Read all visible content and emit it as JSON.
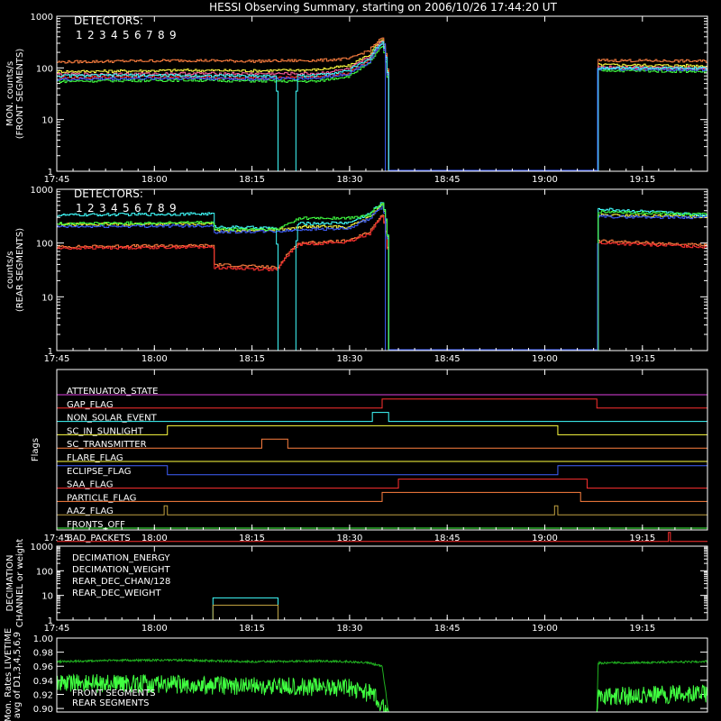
{
  "title": "HESSI Observing Summary, starting on 2006/10/26 17:44:20 UT",
  "time_ticks": [
    "17:45",
    "18:00",
    "18:15",
    "18:30",
    "18:45",
    "19:00",
    "19:15"
  ],
  "time_minutes": [
    0,
    15,
    30,
    45,
    60,
    75,
    90
  ],
  "detectors_label": "DETECTORS:",
  "detector_numbers": [
    "1",
    "2",
    "3",
    "4",
    "5",
    "6",
    "7",
    "8",
    "9"
  ],
  "detector_colors": [
    "#ff3030",
    "#ff60a0",
    "#ff8040",
    "#ffff40",
    "#c0ff40",
    "#40ff40",
    "#40ffa0",
    "#40ffff",
    "#4060ff"
  ],
  "chart_data": [
    {
      "type": "line",
      "panel": "front",
      "ylabel": "MON. counts/s (FRONT SEGMENTS)",
      "ylabel_line1": "MON. counts/s",
      "ylabel_line2": "(FRONT SEGMENTS)",
      "yscale": "log",
      "ylim": [
        1,
        1000
      ],
      "ytick_labels": [
        "1",
        "10",
        "100",
        "1000"
      ],
      "xlim_minutes": [
        0,
        100
      ],
      "series": [
        {
          "color": "#ff3030",
          "x": [
            0,
            10,
            20,
            30,
            40,
            45,
            48,
            50,
            51,
            83,
            83.2,
            100
          ],
          "y": [
            65,
            67,
            66,
            64,
            66,
            80,
            140,
            300,
            1,
            1,
            100,
            95
          ]
        },
        {
          "color": "#ffff40",
          "x": [
            0,
            10,
            20,
            30,
            40,
            45,
            48,
            50,
            51,
            83,
            83.2,
            100
          ],
          "y": [
            85,
            87,
            90,
            88,
            92,
            110,
            180,
            350,
            1,
            1,
            115,
            110
          ]
        },
        {
          "color": "#ff8040",
          "x": [
            0,
            10,
            20,
            30,
            40,
            45,
            48,
            50,
            51,
            83,
            83.2,
            100
          ],
          "y": [
            130,
            135,
            140,
            135,
            140,
            150,
            220,
            380,
            1,
            1,
            140,
            135
          ]
        },
        {
          "color": "#40ff40",
          "x": [
            0,
            10,
            20,
            30,
            40,
            45,
            48,
            50,
            51,
            83,
            83.2,
            100
          ],
          "y": [
            55,
            57,
            58,
            56,
            55,
            70,
            120,
            260,
            1,
            1,
            90,
            85
          ]
        },
        {
          "color": "#ff60a0",
          "x": [
            0,
            10,
            20,
            30,
            40,
            45,
            48,
            50,
            51,
            83,
            83.2,
            100
          ],
          "y": [
            75,
            76,
            78,
            77,
            78,
            95,
            160,
            330,
            1,
            1,
            105,
            100
          ]
        },
        {
          "color": "#4060ff",
          "x": [
            0,
            10,
            20,
            30,
            40,
            45,
            48,
            50,
            51,
            83,
            83.2,
            100
          ],
          "y": [
            60,
            62,
            63,
            61,
            63,
            78,
            130,
            290,
            1,
            1,
            95,
            92
          ]
        },
        {
          "color": "#40ffff",
          "x": [
            0,
            10,
            20,
            33.5,
            34,
            36.5,
            37,
            40,
            45,
            48,
            50,
            51,
            83,
            83.2,
            100
          ],
          "y": [
            70,
            72,
            71,
            70,
            1,
            1,
            70,
            72,
            90,
            150,
            320,
            1,
            1,
            100,
            98
          ]
        }
      ]
    },
    {
      "type": "line",
      "panel": "rear",
      "ylabel": "counts/s (REAR SEGMENTS)",
      "ylabel_line1": "counts/s",
      "ylabel_line2": "(REAR SEGMENTS)",
      "yscale": "log",
      "ylim": [
        1,
        1000
      ],
      "ytick_labels": [
        "1",
        "10",
        "100",
        "1000"
      ],
      "xlim_minutes": [
        0,
        100
      ],
      "series": [
        {
          "color": "#ff8040",
          "x": [
            0,
            10,
            24,
            24.2,
            34,
            37,
            37.2,
            45,
            48,
            50,
            51,
            83,
            83.2,
            100
          ],
          "y": [
            85,
            88,
            90,
            40,
            35,
            95,
            100,
            110,
            160,
            330,
            1,
            1,
            110,
            90
          ]
        },
        {
          "color": "#ff3030",
          "x": [
            0,
            10,
            24,
            24.2,
            34,
            37,
            37.2,
            45,
            48,
            50,
            51,
            83,
            83.2,
            100
          ],
          "y": [
            80,
            82,
            85,
            35,
            32,
            90,
            95,
            105,
            150,
            310,
            1,
            1,
            100,
            85
          ]
        },
        {
          "color": "#ffff40",
          "x": [
            0,
            10,
            24,
            24.2,
            34,
            37,
            37.2,
            45,
            48,
            50,
            51,
            83,
            83.2,
            100
          ],
          "y": [
            220,
            225,
            230,
            170,
            180,
            190,
            200,
            200,
            300,
            520,
            1,
            1,
            330,
            310
          ]
        },
        {
          "color": "#4060ff",
          "x": [
            0,
            10,
            24,
            24.2,
            34,
            37,
            37.2,
            45,
            48,
            50,
            51,
            83,
            83.2,
            100
          ],
          "y": [
            200,
            205,
            210,
            160,
            165,
            175,
            180,
            185,
            280,
            480,
            1,
            1,
            310,
            300
          ]
        },
        {
          "color": "#40ffff",
          "x": [
            0,
            10,
            24,
            24.2,
            33.5,
            34,
            36.5,
            37,
            37.2,
            45,
            48,
            50,
            51,
            83,
            83.2,
            100
          ],
          "y": [
            330,
            340,
            350,
            200,
            190,
            1,
            1,
            220,
            230,
            240,
            350,
            560,
            1,
            1,
            430,
            330
          ]
        },
        {
          "color": "#40ff40",
          "x": [
            0,
            10,
            24,
            24.2,
            34,
            37,
            37.2,
            45,
            48,
            50,
            51,
            83,
            83.2,
            100
          ],
          "y": [
            230,
            235,
            240,
            180,
            180,
            280,
            290,
            290,
            330,
            550,
            1,
            1,
            380,
            340
          ]
        }
      ]
    },
    {
      "type": "line",
      "panel": "flags",
      "ylabel": "Flags",
      "xlim_minutes": [
        0,
        100
      ],
      "flags": [
        {
          "name": "ATTENUATOR_STATE",
          "color": "#e040e0",
          "x": [
            0,
            100
          ],
          "state": [
            0,
            0
          ]
        },
        {
          "name": "GAP_FLAG",
          "color": "#ff3030",
          "x": [
            0,
            50,
            50,
            83,
            83,
            100
          ],
          "state": [
            0,
            0,
            1,
            1,
            0,
            0
          ]
        },
        {
          "name": "NON_SOLAR_EVENT",
          "color": "#40ffff",
          "x": [
            0,
            48.5,
            48.5,
            51,
            51,
            100
          ],
          "state": [
            0,
            0,
            1,
            1,
            0,
            0
          ]
        },
        {
          "name": "SC_IN_SUNLIGHT",
          "color": "#ffff40",
          "x": [
            0,
            17,
            17,
            77,
            77,
            100
          ],
          "state": [
            0,
            0,
            1,
            1,
            0,
            0
          ]
        },
        {
          "name": "SC_TRANSMITTER",
          "color": "#ff8040",
          "x": [
            0,
            31.5,
            31.5,
            35.5,
            35.5,
            100
          ],
          "state": [
            0,
            0,
            1,
            1,
            0,
            0
          ]
        },
        {
          "name": "FLARE_FLAG",
          "color": "#ffff40",
          "x": [
            0,
            100
          ],
          "state": [
            0,
            0
          ]
        },
        {
          "name": "ECLIPSE_FLAG",
          "color": "#4060ff",
          "x": [
            0,
            17,
            17,
            77,
            77,
            100
          ],
          "state": [
            1,
            1,
            0,
            0,
            1,
            1
          ]
        },
        {
          "name": "SAA_FLAG",
          "color": "#ff3030",
          "x": [
            0,
            52.5,
            52.5,
            81.5,
            81.5,
            100
          ],
          "state": [
            0,
            0,
            1,
            1,
            0,
            0
          ]
        },
        {
          "name": "PARTICLE_FLAG",
          "color": "#ff8040",
          "x": [
            0,
            50,
            50,
            80.5,
            80.5,
            100
          ],
          "state": [
            0,
            0,
            1,
            1,
            0,
            0
          ]
        },
        {
          "name": "AAZ_FLAG",
          "color": "#c0a040",
          "x": [
            0,
            16.5,
            16.5,
            17,
            17,
            76.5,
            76.5,
            77,
            77,
            100
          ],
          "state": [
            0,
            0,
            1,
            1,
            0,
            0,
            1,
            1,
            0,
            0
          ]
        },
        {
          "name": "FRONTS_OFF",
          "color": "#40ff40",
          "x": [
            0,
            100
          ],
          "state": [
            0,
            0
          ]
        },
        {
          "name": "BAD_PACKETS",
          "color": "#ff3030",
          "x": [
            0,
            94,
            94,
            94.3,
            94.3,
            100
          ],
          "state": [
            0,
            0,
            1,
            1,
            0,
            0
          ]
        }
      ]
    },
    {
      "type": "line",
      "panel": "decimation",
      "ylabel": "DECIMATION CHANNEL or weight",
      "ylabel_line1": "DECIMATION",
      "ylabel_line2": "CHANNEL or weight",
      "yscale": "log",
      "ylim": [
        1,
        1000
      ],
      "ytick_labels": [
        "1",
        "10",
        "100",
        "1000"
      ],
      "xlim_minutes": [
        0,
        100
      ],
      "series": [
        {
          "name": "DECIMATION_ENERGY",
          "color": "#40ff40",
          "x": [
            0,
            100
          ],
          "y": [
            1,
            1
          ]
        },
        {
          "name": "DECIMATION_WEIGHT",
          "color": "#ff3030",
          "x": [
            0,
            100
          ],
          "y": [
            1,
            1
          ]
        },
        {
          "name": "REAR_DEC_CHAN/128",
          "color": "#40ffff",
          "x": [
            0,
            24,
            24,
            34,
            34,
            100
          ],
          "y": [
            1,
            1,
            8,
            8,
            1,
            1
          ]
        },
        {
          "name": "REAR_DEC_WEIGHT",
          "color": "#c0a040",
          "x": [
            0,
            24,
            24,
            34,
            34,
            100
          ],
          "y": [
            1,
            1,
            4,
            4,
            1,
            1
          ]
        }
      ]
    },
    {
      "type": "line",
      "panel": "livetime",
      "ylabel": "Mon. Rates LIVETIME avg of D1,3,4,5,6,9",
      "ylabel_line1": "Mon. Rates LIVETIME",
      "ylabel_line2": "avg of D1,3,4,5,6,9",
      "yscale": "linear",
      "ylim": [
        0.895,
        1.0
      ],
      "ytick_labels": [
        "0.90",
        "0.92",
        "0.94",
        "0.96",
        "0.98",
        "1.00"
      ],
      "xlim_minutes": [
        0,
        100
      ],
      "series": [
        {
          "name": "FRONT SEGMENTS",
          "color": "#40ff40",
          "x": [
            0,
            10,
            20,
            30,
            40,
            45,
            48,
            50,
            51,
            83,
            83.2,
            100
          ],
          "y": [
            0.95,
            0.948,
            0.947,
            0.945,
            0.944,
            0.942,
            0.935,
            0.92,
            0.895,
            0.895,
            0.93,
            0.935
          ]
        },
        {
          "name": "REAR SEGMENTS",
          "color": "#20b020",
          "x": [
            0,
            10,
            20,
            30,
            40,
            45,
            48,
            50,
            51,
            83,
            83.2,
            100
          ],
          "y": [
            0.968,
            0.97,
            0.97,
            0.968,
            0.969,
            0.968,
            0.966,
            0.962,
            0.895,
            0.895,
            0.966,
            0.968
          ]
        }
      ]
    }
  ]
}
